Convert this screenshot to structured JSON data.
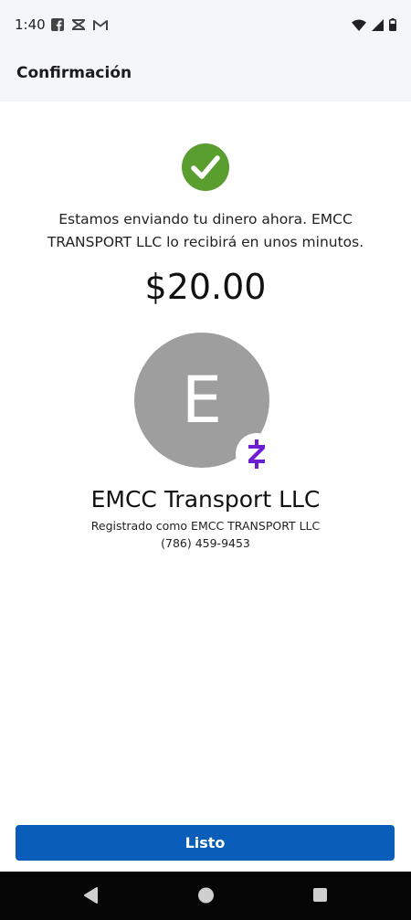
{
  "status_bar": {
    "time": "1:40",
    "notification_icons": [
      "facebook-icon",
      "capcut-icon",
      "gmail-icon"
    ],
    "system_icons": [
      "wifi-icon",
      "signal-icon",
      "battery-icon"
    ]
  },
  "header": {
    "title": "Confirmación"
  },
  "confirmation": {
    "message": "Estamos enviando tu dinero ahora. EMCC TRANSPORT LLC lo recibirá en unos minutos.",
    "amount": "$20.00"
  },
  "recipient": {
    "avatar_initial": "E",
    "badge_icon": "zelle-icon",
    "name": "EMCC Transport LLC",
    "registered_as": "Registrado como EMCC TRANSPORT LLC",
    "phone": "(786) 459-9453"
  },
  "actions": {
    "done_label": "Listo"
  },
  "nav_bar": {
    "buttons": [
      "back-icon",
      "home-icon",
      "recents-icon"
    ]
  },
  "colors": {
    "primary": "#0a5db9",
    "success": "#5a9e2f",
    "avatar": "#9e9e9e",
    "zelle": "#6d1ed4",
    "header_bg": "#f5f6fa"
  }
}
